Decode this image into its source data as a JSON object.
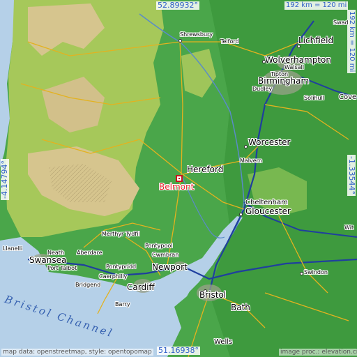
{
  "coords": {
    "top": "52.89932°",
    "bottom": "51.16938°",
    "left": "-4.14794°",
    "right": "-1.33544°"
  },
  "scale": {
    "top": "192 km = 120 mi",
    "right": "192 km = 120 mi"
  },
  "highlight": "Belmont",
  "places": {
    "shrewsbury": "Shrewsbury",
    "telford": "Telford",
    "lichfield": "Lichfield",
    "swadlincote": "Swad",
    "wolverhampton": "Wolverhampton",
    "walsall": "Walsall",
    "tipton": "Tipton",
    "birmingham": "Birmingham",
    "dudley": "Dudley",
    "solihull": "Solihull",
    "coventry": "Cove",
    "worcester": "Worcester",
    "malvern": "Malvern",
    "hereford": "Hereford",
    "cheltenham": "Cheltenham",
    "gloucester": "Gloucester",
    "merthyr": "Merthyr Tydfil",
    "pontypool": "Pontypool",
    "llanelli": "Llanelli",
    "neath": "Neath",
    "aberdare": "Aberdare",
    "cwmbran": "Cwmbran",
    "swansea": "Swansea",
    "porttalbot": "Port Talbot",
    "pontypridd": "Pontypridd",
    "newport": "Newport",
    "caerphilly": "Caerphilly",
    "bridgend": "Bridgend",
    "cardiff": "Cardiff",
    "barry": "Barry",
    "swindon": "Swindon",
    "bristol": "Bristol",
    "bath": "Bath",
    "wells": "Wells",
    "witney": "Wit"
  },
  "sea": "Bristol Channel",
  "attribution": {
    "left": "map data: openstreetmap, style: opentopomap",
    "right": "image proc.: elevation.city"
  }
}
